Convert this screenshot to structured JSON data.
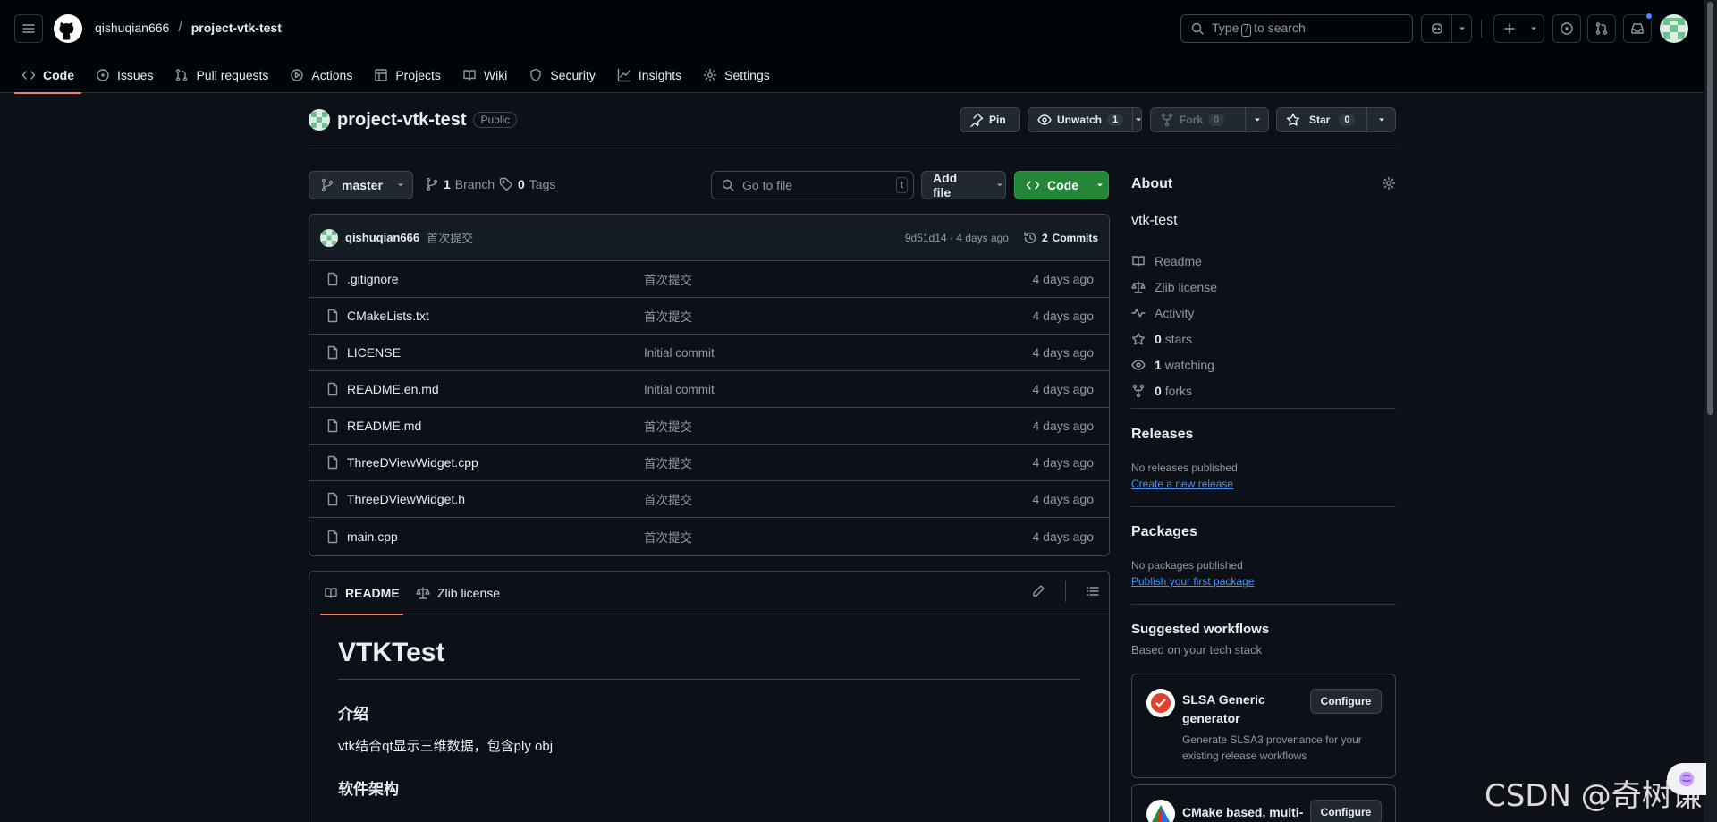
{
  "header": {
    "owner": "qishuqian666",
    "separator": "/",
    "repo": "project-vtk-test",
    "search": {
      "prefix": "Type",
      "key": "/",
      "suffix": "to search"
    },
    "has_notification": true
  },
  "repo_nav": {
    "items": [
      {
        "label": "Code",
        "icon": "code-icon",
        "active": true
      },
      {
        "label": "Issues",
        "icon": "issue-icon"
      },
      {
        "label": "Pull requests",
        "icon": "pull-request-icon"
      },
      {
        "label": "Actions",
        "icon": "play-icon"
      },
      {
        "label": "Projects",
        "icon": "table-icon"
      },
      {
        "label": "Wiki",
        "icon": "book-icon"
      },
      {
        "label": "Security",
        "icon": "shield-icon"
      },
      {
        "label": "Insights",
        "icon": "graph-icon"
      },
      {
        "label": "Settings",
        "icon": "gear-icon"
      }
    ]
  },
  "repo_header": {
    "name": "project-vtk-test",
    "visibility": "Public",
    "pin_label": "Pin",
    "unwatch_label": "Unwatch",
    "watch_count": "1",
    "fork_label": "Fork",
    "fork_count": "0",
    "star_label": "Star",
    "star_count": "0"
  },
  "toolbar": {
    "branch": "master",
    "branches_count": "1",
    "branches_label": "Branch",
    "tags_count": "0",
    "tags_label": "Tags",
    "goto_placeholder": "Go to file",
    "goto_key": "t",
    "add_file_label": "Add file",
    "code_label": "Code"
  },
  "commit": {
    "author": "qishuqian666",
    "message": "首次提交",
    "hash": "9d51d14",
    "sep": "·",
    "age": "4 days ago",
    "commits_count": "2",
    "commits_label": "Commits"
  },
  "files": [
    {
      "name": ".gitignore",
      "message": "首次提交",
      "date": "4 days ago"
    },
    {
      "name": "CMakeLists.txt",
      "message": "首次提交",
      "date": "4 days ago"
    },
    {
      "name": "LICENSE",
      "message": "Initial commit",
      "date": "4 days ago"
    },
    {
      "name": "README.en.md",
      "message": "Initial commit",
      "date": "4 days ago"
    },
    {
      "name": "README.md",
      "message": "首次提交",
      "date": "4 days ago"
    },
    {
      "name": "ThreeDViewWidget.cpp",
      "message": "首次提交",
      "date": "4 days ago"
    },
    {
      "name": "ThreeDViewWidget.h",
      "message": "首次提交",
      "date": "4 days ago"
    },
    {
      "name": "main.cpp",
      "message": "首次提交",
      "date": "4 days ago"
    }
  ],
  "readme": {
    "tabs": [
      {
        "label": "README",
        "active": true
      },
      {
        "label": "Zlib license"
      }
    ],
    "title": "VTKTest",
    "section1": "介绍",
    "intro": "vtk结合qt显示三维数据，包含ply obj",
    "section2": "软件架构"
  },
  "sidebar": {
    "about_title": "About",
    "description": "vtk-test",
    "items": [
      {
        "icon": "book-icon",
        "count": "",
        "label": "Readme"
      },
      {
        "icon": "scale-icon",
        "count": "",
        "label": "Zlib license"
      },
      {
        "icon": "pulse-icon",
        "count": "",
        "label": "Activity"
      },
      {
        "icon": "star-icon",
        "count": "0",
        "label": "stars"
      },
      {
        "icon": "eye-icon",
        "count": "1",
        "label": "watching"
      },
      {
        "icon": "fork-icon",
        "count": "0",
        "label": "forks"
      }
    ],
    "releases_title": "Releases",
    "releases_empty": "No releases published",
    "releases_link": "Create a new release",
    "packages_title": "Packages",
    "packages_empty": "No packages published",
    "packages_link": "Publish your first package",
    "workflows_title": "Suggested workflows",
    "workflows_subtitle": "Based on your tech stack",
    "workflows": [
      {
        "title": "SLSA Generic generator",
        "description": "Generate SLSA3 provenance for your existing release workflows",
        "button": "Configure"
      },
      {
        "title": "CMake based, multi-",
        "description": "",
        "button": "Configure"
      }
    ]
  },
  "watermark": "CSDN @奇树谦",
  "colors": {
    "accent": "#f78166",
    "link": "#4493f8",
    "primary_button": "#238636",
    "bg": "#0d1117"
  }
}
